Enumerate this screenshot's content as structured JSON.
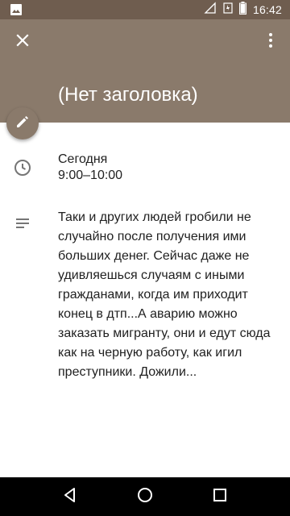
{
  "status_bar": {
    "time": "16:42",
    "icons": [
      "image-icon",
      "wifi-off-icon",
      "no-signal-icon",
      "battery-charging-icon"
    ]
  },
  "toolbar": {
    "close_icon": "close-icon",
    "menu_icon": "more-vert-icon"
  },
  "event": {
    "title": "(Нет заголовка)",
    "date": "Сегодня",
    "time_range": "9:00–10:00",
    "description": "Таки и других людей гробили не случайно после получения ими больших денег. Сейчас даже не удивляешься случаям с иными гражданами, когда им приходит конец в дтп...А аварию можно заказать мигранту, они и едут сюда как на черную работу, как игил преступники. Дожили...",
    "edit_icon": "edit-pencil-icon",
    "time_icon": "clock-icon",
    "description_icon": "notes-icon"
  },
  "nav_bar": {
    "buttons": [
      "back-icon",
      "home-icon",
      "recents-icon"
    ]
  },
  "colors": {
    "header": "#8a7a6b",
    "status_bar": "#6f5d4f",
    "text": "#212121",
    "icon": "#757575"
  }
}
